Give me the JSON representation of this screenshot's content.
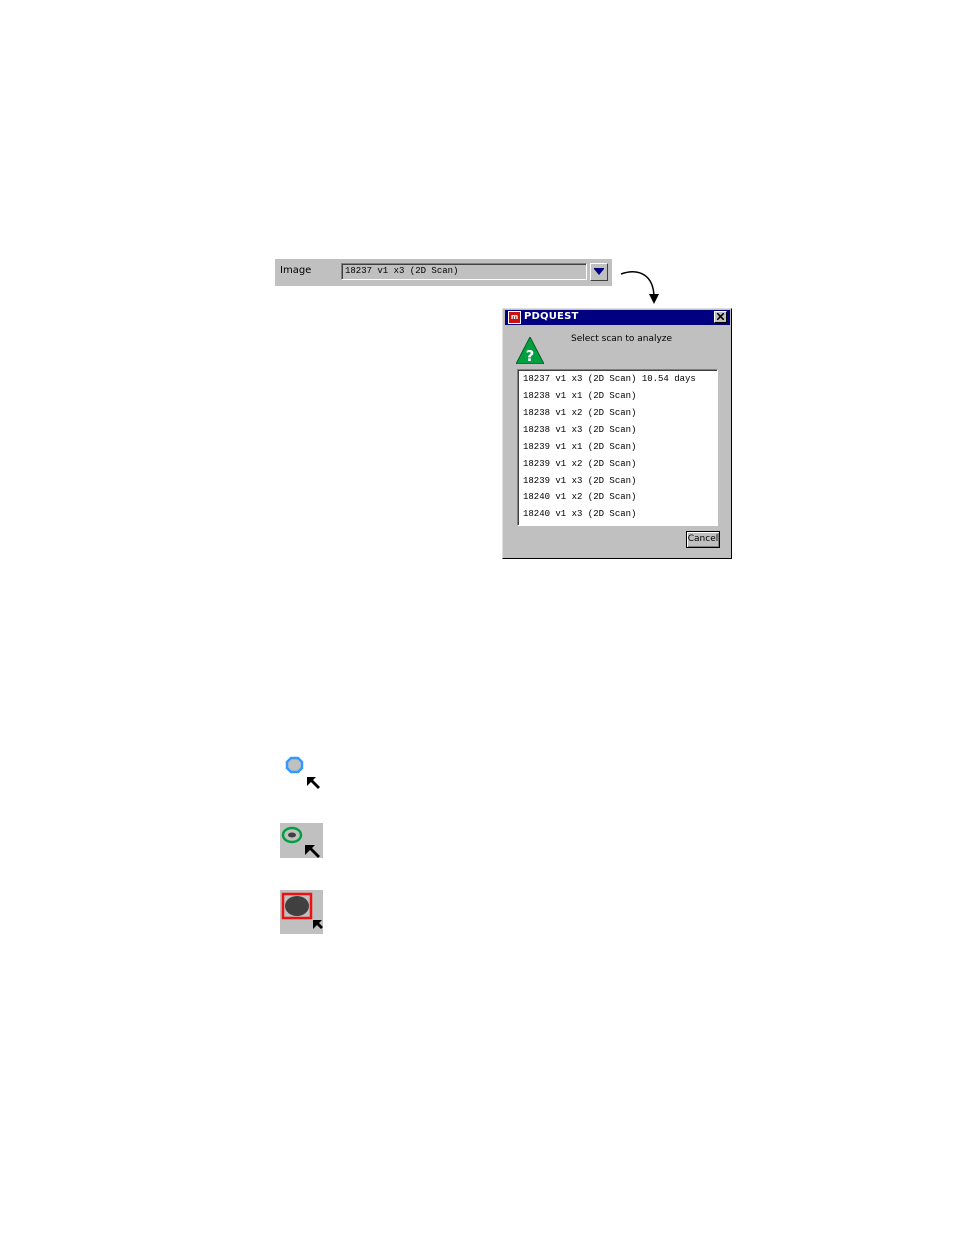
{
  "image_selector": {
    "label": "Image",
    "value": "18237 v1 x3 (2D Scan)"
  },
  "dialog": {
    "title": "PDQUEST",
    "app_icon_text": "m",
    "prompt": "Select scan to analyze",
    "items": [
      "18237 v1 x3 (2D Scan) 10.54 days",
      "18238 v1 x1 (2D Scan)",
      "18238 v1 x2 (2D Scan)",
      "18238 v1 x3 (2D Scan)",
      "18239 v1 x1 (2D Scan)",
      "18239 v1 x2 (2D Scan)",
      "18239 v1 x3 (2D Scan)",
      "18240 v1 x2 (2D Scan)",
      "18240 v1 x3 (2D Scan)"
    ],
    "cancel_label": "Cancel"
  },
  "tool_icons": [
    {
      "name": "blue-spot-select-icon",
      "color": "#3399ff"
    },
    {
      "name": "green-spot-select-icon",
      "color": "#00a040"
    },
    {
      "name": "red-box-spot-select-icon",
      "color": "#ee1111"
    }
  ],
  "colors": {
    "titlebar": "#000080",
    "window_face": "#c0c0c0",
    "question_icon": "#00a040"
  }
}
